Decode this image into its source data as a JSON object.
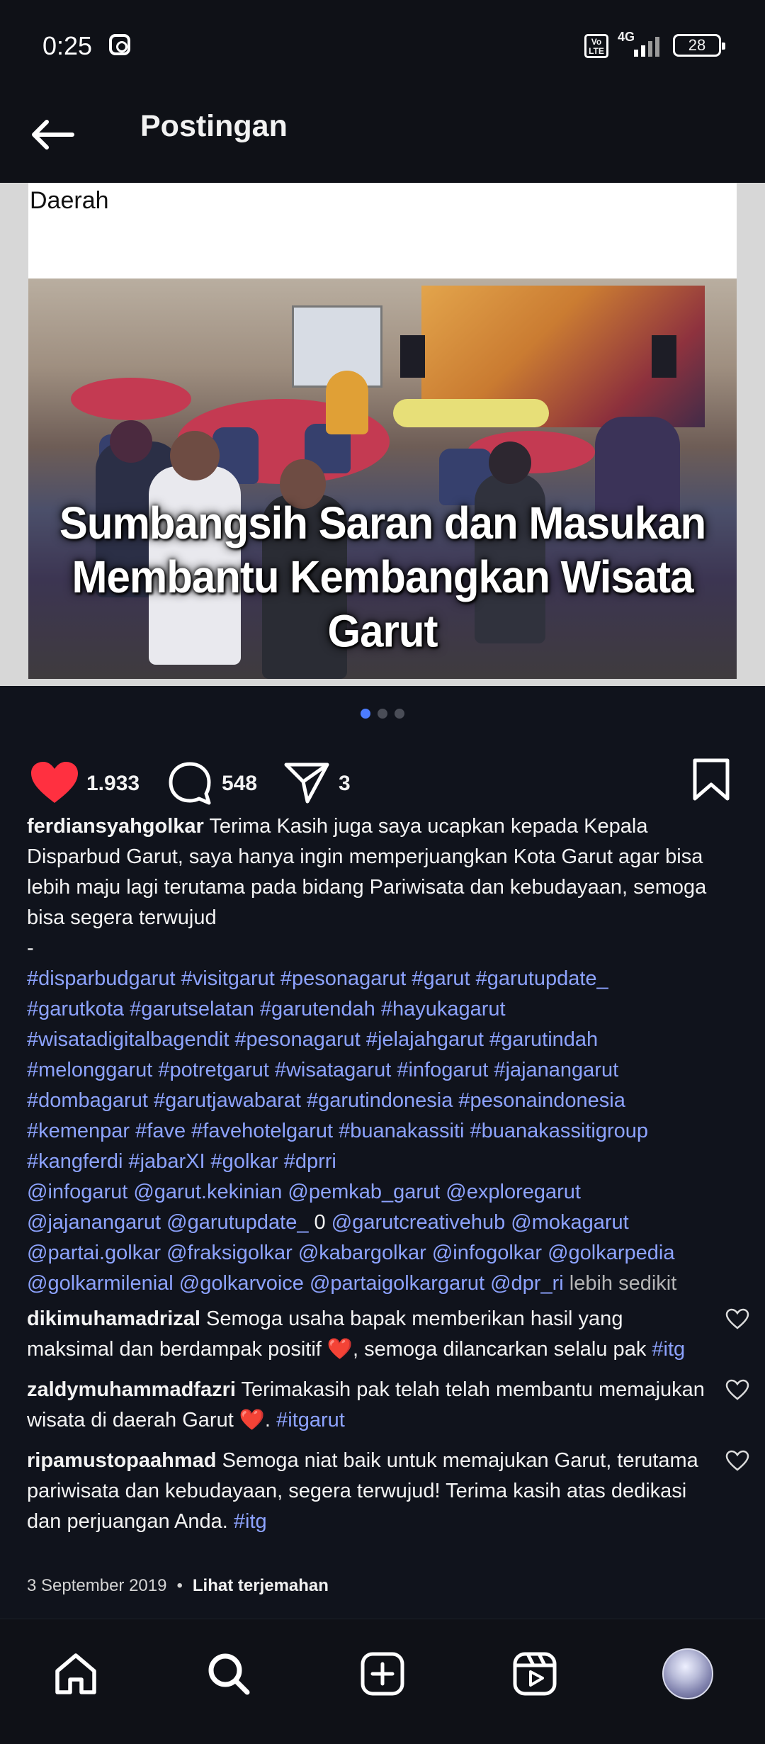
{
  "status": {
    "time": "0:25",
    "network": "4G",
    "battery": "28",
    "volte": "Vo LTE"
  },
  "header": {
    "title": "Postingan"
  },
  "post": {
    "image_top_text": "Daerah",
    "image_caption_line1": "Sumbangsih Saran dan Masukan",
    "image_caption_line2": "Membantu Kembangkan Wisata Garut",
    "likes": "1.933",
    "comments": "548",
    "shares": "3",
    "username": "ferdiansyahgolkar",
    "caption": "Terima Kasih juga saya ucapkan kepada Kepala Disparbud Garut,  saya hanya ingin memperjuangkan Kota Garut agar bisa lebih maju lagi terutama pada bidang Pariwisata dan kebudayaan, semoga bisa segera terwujud",
    "separator": "-",
    "hashtags_line1": "#disparbudgarut #visitgarut #pesonagarut #garut #garutupdate_",
    "hashtags_line2": "#garutkota #garutselatan #garutendah #hayukagarut",
    "hashtags_line3": "#wisatadigitalbagendit #pesonagarut #jelajahgarut #garutindah",
    "hashtags_line4": "#melonggarut #potretgarut #wisatagarut #infogarut #jajanangarut",
    "hashtags_line5": "#dombagarut #garutjawabarat #garutindonesia #pesonaindonesia",
    "hashtags_line6": "#kemenpar #fave #favehotelgarut #buanakassiti #buanakassitigroup",
    "hashtags_line7": "#kangferdi #jabarXI #golkar #dprri",
    "mentions_line1": "@infogarut @garut.kekinian @pemkab_garut @exploregarut",
    "mentions_line2a": "@jajanangarut @garutupdate_",
    "mentions_line2b": " 0 ",
    "mentions_line2c": "@garutcreativehub @mokagarut",
    "mentions_line3": "@partai.golkar @fraksigolkar @kabargolkar @infogolkar @golkarpedia",
    "mentions_line4": "@golkarmilenial @golkarvoice @partaigolkargarut @dpr_ri",
    "less_label": "lebih sedikit",
    "date": "3 September 2019",
    "translate_label": "Lihat terjemahan"
  },
  "comments": [
    {
      "user": "dikimuhamadrizal",
      "text": "Semoga usaha bapak memberikan hasil yang maksimal dan berdampak positif ❤️, semoga dilancarkan selalu pak",
      "tag": "#itg"
    },
    {
      "user": "zaldymuhammadfazri",
      "text": "Terimakasih pak telah telah membantu memajukan wisata di daerah Garut ❤️.",
      "tag": "#itgarut"
    },
    {
      "user": "ripamustopaahmad",
      "text": "Semoga niat baik untuk memajukan Garut, terutama pariwisata dan kebudayaan, segera terwujud! Terima kasih atas dedikasi dan perjuangan Anda.",
      "tag": "#itg"
    }
  ],
  "icons": {
    "back": "arrow-left-icon",
    "like": "heart-filled-icon",
    "comment": "comment-icon",
    "share": "send-icon",
    "save": "bookmark-icon",
    "home": "home-icon",
    "search": "search-icon",
    "create": "add-post-icon",
    "reels": "reels-icon"
  },
  "colors": {
    "background": "#10131c",
    "tag": "#8da3ff",
    "like": "#ff3040",
    "carousel_active": "#4c7cff"
  },
  "carousel": {
    "active_index": 0,
    "count": 3
  }
}
